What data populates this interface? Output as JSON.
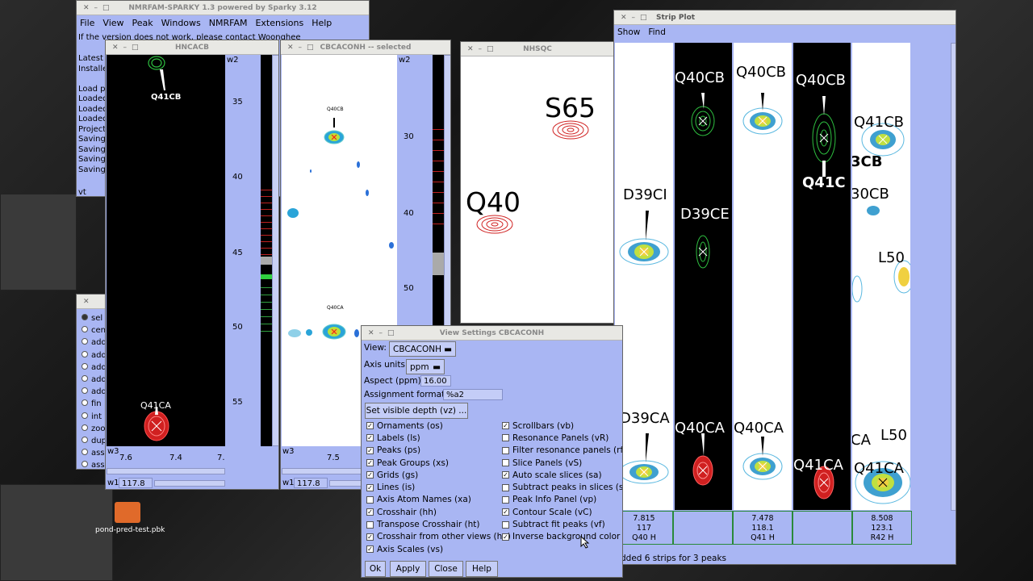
{
  "main_window": {
    "title": "NMRFAM-SPARKY 1.3 powered by Sparky 3.12",
    "menu": [
      "File",
      "View",
      "Peak",
      "Windows",
      "NMRFAM",
      "Extensions",
      "Help"
    ],
    "log_first_line": "If the version does not work, please contact Woonghee",
    "log_lines": [
      "Latest E",
      "Installe",
      "",
      "Load pr",
      "Loaded",
      "Loaded",
      "Loaded",
      "Project",
      "Saving",
      "Saving",
      "Saving",
      "Saving"
    ],
    "prompt_text": "vt"
  },
  "side_panel": {
    "items": [
      "sel",
      "cen",
      "add",
      "add",
      "add",
      "add",
      "add",
      "fin",
      "int",
      "zoo",
      "dup",
      "ass",
      "ass"
    ]
  },
  "desktop": {
    "folder_label": "pond-pred-test.pbk"
  },
  "hncacb": {
    "title": "HNCACB",
    "axis_label": "w2",
    "y_ticks": [
      "35",
      "40",
      "45",
      "50",
      "55"
    ],
    "x_ticks": [
      "7.6",
      "7.4",
      "7."
    ],
    "x_label": "w3",
    "w1_label": "w1",
    "w1_value": "117.8",
    "peak_top": "Q41CB",
    "peak_bottom": "Q41CA"
  },
  "cbcaconh": {
    "title": "CBCACONH -- selected",
    "axis_label": "w2",
    "y_ticks": [
      "30",
      "40",
      "50"
    ],
    "x_ticks": [
      "7.5"
    ],
    "x_label": "w3",
    "w1_label": "w1",
    "w1_value": "117.8",
    "peak_top": "Q40CB",
    "peak_mid": "Q40CA"
  },
  "nhsqc": {
    "title": "NHSQC",
    "peak_a": "S65",
    "peak_b": "Q40"
  },
  "strip_plot": {
    "title": "Strip Plot",
    "menu": [
      "Show",
      "Find"
    ],
    "strip_labels": [
      [
        "D39CI",
        "D39CA"
      ],
      [
        "Q40CB",
        "D39CE",
        "Q40CA"
      ],
      [
        "Q40CB",
        "Q40CA"
      ],
      [
        "Q40CB",
        "Q41C",
        "Q41CA"
      ],
      [
        "Q41CB",
        "3CB",
        "30CB",
        "L50",
        "CA",
        "L50",
        "Q41CA"
      ]
    ],
    "cells": [
      [
        "7.815",
        "117",
        "Q40 H"
      ],
      [
        "",
        "",
        ""
      ],
      [
        "7.478",
        "118.1",
        "Q41 H"
      ],
      [
        "",
        "",
        ""
      ],
      [
        "8.508",
        "123.1",
        "R42 H"
      ]
    ],
    "status": "dded 6 strips for 3 peaks"
  },
  "view_settings": {
    "title": "View Settings CBCACONH",
    "view_label": "View:",
    "view_value": "CBCACONH",
    "axis_units_label": "Axis units:",
    "axis_units_value": "ppm",
    "aspect_label": "Aspect (ppm):",
    "aspect_value": "16.00",
    "assign_label": "Assignment format:",
    "assign_value": "%a2",
    "depth_button": "Set visible depth (vz) ...",
    "left_options": [
      {
        "label": "Ornaments (os)",
        "checked": true
      },
      {
        "label": "Labels (ls)",
        "checked": true
      },
      {
        "label": "Peaks (ps)",
        "checked": true
      },
      {
        "label": "Peak Groups (xs)",
        "checked": true
      },
      {
        "label": "Grids (gs)",
        "checked": true
      },
      {
        "label": "Lines (is)",
        "checked": true
      },
      {
        "label": "Axis Atom Names (xa)",
        "checked": false
      },
      {
        "label": "Crosshair (hh)",
        "checked": true
      },
      {
        "label": "Transpose Crosshair (ht)",
        "checked": false
      },
      {
        "label": "Crosshair from other views (ho)",
        "checked": true
      },
      {
        "label": "Axis Scales (vs)",
        "checked": true
      }
    ],
    "right_options": [
      {
        "label": "Scrollbars (vb)",
        "checked": true
      },
      {
        "label": "Resonance Panels (vR)",
        "checked": false
      },
      {
        "label": "Filter resonance panels (rf)",
        "checked": false
      },
      {
        "label": "Slice Panels (vS)",
        "checked": false
      },
      {
        "label": "Auto scale slices (sa)",
        "checked": true
      },
      {
        "label": "Subtract peaks in slices (sf)",
        "checked": false
      },
      {
        "label": "Peak Info Panel (vp)",
        "checked": false
      },
      {
        "label": "Contour Scale (vC)",
        "checked": true
      },
      {
        "label": "Subtract fit peaks (vf)",
        "checked": false
      },
      {
        "label": "Inverse background color (ci)",
        "checked": true
      }
    ],
    "buttons": [
      "Ok",
      "Apply",
      "Close",
      "Help"
    ]
  },
  "colors": {
    "panel": "#a9b6f3",
    "peak_red": "#d02020",
    "peak_green": "#20b030"
  }
}
